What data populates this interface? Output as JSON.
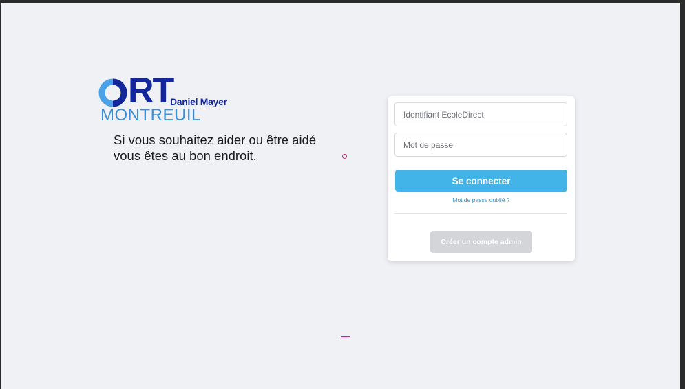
{
  "logo": {
    "letters": "RT",
    "subtitle": "Daniel Mayer",
    "city": "MONTREUIL",
    "colors": {
      "navy": "#13279a",
      "light_blue": "#3b8fd9",
      "ring_blue": "#4aa3e8"
    }
  },
  "tagline": {
    "line1": "Si vous souhaitez aider ou être aidé",
    "line2": "vous êtes au bon endroit."
  },
  "login": {
    "id_placeholder": "Identifiant EcoleDirect",
    "password_placeholder": "Mot de passe",
    "submit_label": "Se connecter",
    "forgot_label": "Mot de passe oublié ?",
    "create_admin_label": "Créer un compte admin"
  },
  "colors": {
    "background": "#f0f1f5",
    "primary_button": "#43b4e8",
    "disabled_button": "#d3d5d9",
    "link": "#2d8fd0",
    "marker": "#d0217f"
  }
}
